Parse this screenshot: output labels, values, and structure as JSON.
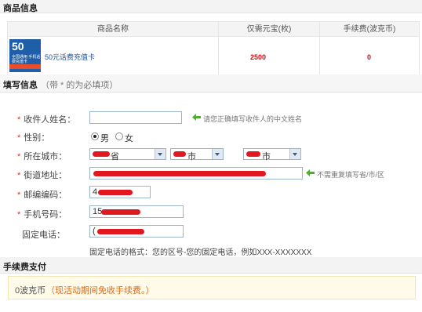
{
  "product_section": {
    "title": "商品信息"
  },
  "table": {
    "headers": [
      "商品名称",
      "仅需元宝(枚)",
      "手续费(波克币)"
    ],
    "product": {
      "card_value": "50",
      "card_caption": "全国通用 手机话费充值卡",
      "name": "50元话费充值卡",
      "price": "2500",
      "fee": "0"
    }
  },
  "fill_section": {
    "title": "填写信息",
    "note": "（带 * 的为必填项）"
  },
  "form": {
    "recipient_label": "收件人姓名：",
    "recipient_hint": "请您正确填写收件人的中文姓名",
    "gender_label": "性别：",
    "gender_male": "男",
    "gender_female": "女",
    "city_label": "所在城市：",
    "province_suffix": "省",
    "city_suffix": "市",
    "district_suffix": "市",
    "street_label": "街道地址：",
    "street_hint": "不需重复填写省/市/区",
    "zip_label": "邮编编码：",
    "zip_value": "4",
    "mobile_label": "手机号码：",
    "mobile_value": "15",
    "phone_label": "固定电话：",
    "phone_value": "(",
    "phone_format": "固定电话的格式：您的区号-您的固定电话，例如XXX-XXXXXXX"
  },
  "fee_section": {
    "title": "手续费支付",
    "value": "0波克币",
    "note": "（现活动期间免收手续费。）"
  },
  "colors": {
    "accent_red": "#d70c19",
    "link_blue": "#1e4f9a",
    "hint_green": "#4fae2e"
  }
}
